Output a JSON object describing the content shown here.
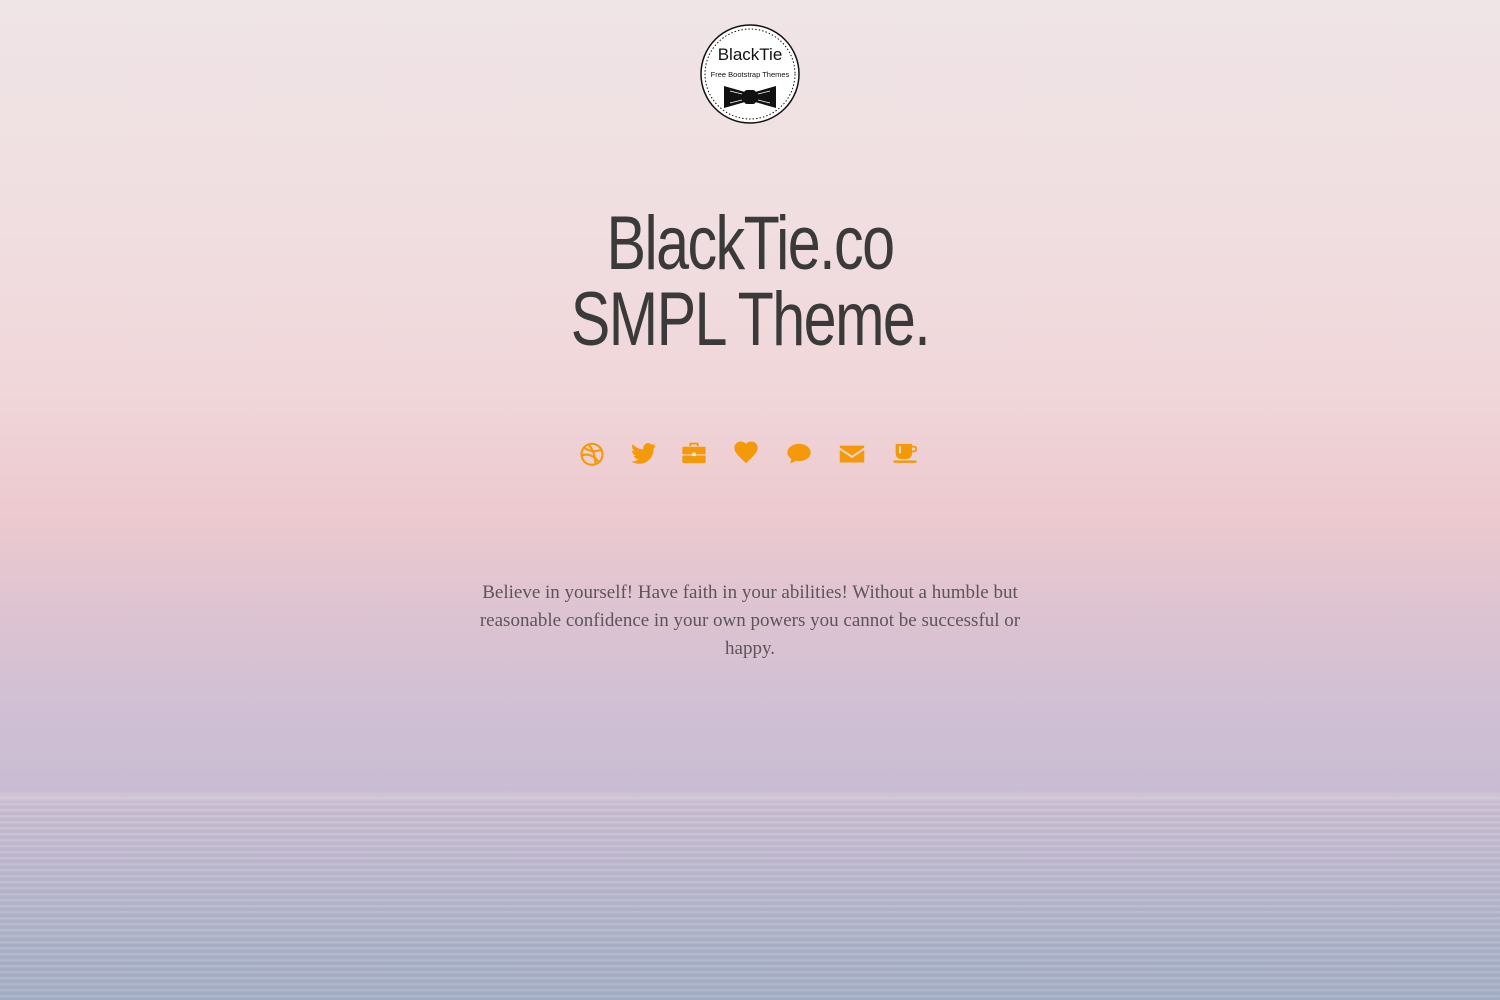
{
  "logo": {
    "title": "BlackTie",
    "subtitle": "Free Bootstrap Themes",
    "icon": "bowtie-icon"
  },
  "headline": {
    "line1": "BlackTie.co",
    "line2": "SMPL Theme."
  },
  "social_icons": [
    {
      "name": "dribbble-icon"
    },
    {
      "name": "twitter-icon"
    },
    {
      "name": "briefcase-icon"
    },
    {
      "name": "heart-icon"
    },
    {
      "name": "comment-icon"
    },
    {
      "name": "envelope-icon"
    },
    {
      "name": "coffee-icon"
    }
  ],
  "quote": "Believe in yourself! Have faith in your abilities! Without a humble but reasonable confidence in your own powers you cannot be successful or happy.",
  "colors": {
    "accent": "#f49a0a",
    "text": "#3a3a3a",
    "quote_text": "#5b5558"
  }
}
